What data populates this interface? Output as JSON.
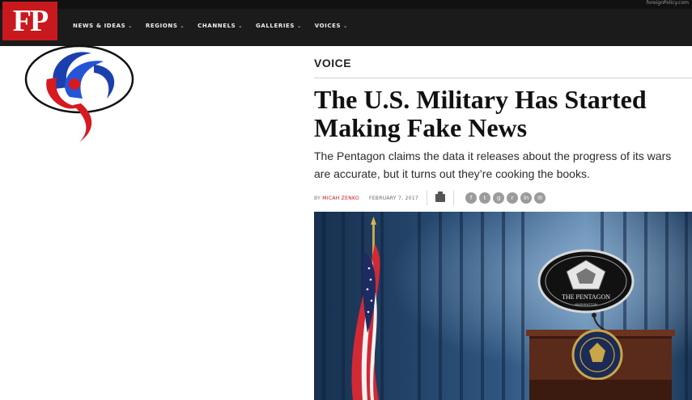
{
  "header": {
    "logo_text": "FP",
    "top_url": "foreignPolicy.com",
    "nav": [
      {
        "label": "NEWS & IDEAS"
      },
      {
        "label": "REGIONS"
      },
      {
        "label": "CHANNELS"
      },
      {
        "label": "GALLERIES"
      },
      {
        "label": "VOICES"
      }
    ]
  },
  "article": {
    "section": "VOICE",
    "headline_line1": "The U.S. Military Has Started",
    "headline_line2": "Making Fake News",
    "dek": "The Pentagon claims the data it releases about the progress of its wars are accurate, but it turns out they’re cooking the books.",
    "byline_prefix": "BY",
    "author": "MICAH ZENKO",
    "date": "FEBRUARY 7, 2017",
    "share_icons": [
      "facebook-icon",
      "twitter-icon",
      "googleplus-icon",
      "reddit-icon",
      "linkedin-icon",
      "email-icon"
    ]
  },
  "hero": {
    "seal_title": "THE PENTAGON",
    "seal_subtitle": "WASHINGTON"
  },
  "colors": {
    "brand_red": "#c8191e",
    "nav_bg": "#1b1b1b",
    "curtain": "#2b4f78"
  }
}
